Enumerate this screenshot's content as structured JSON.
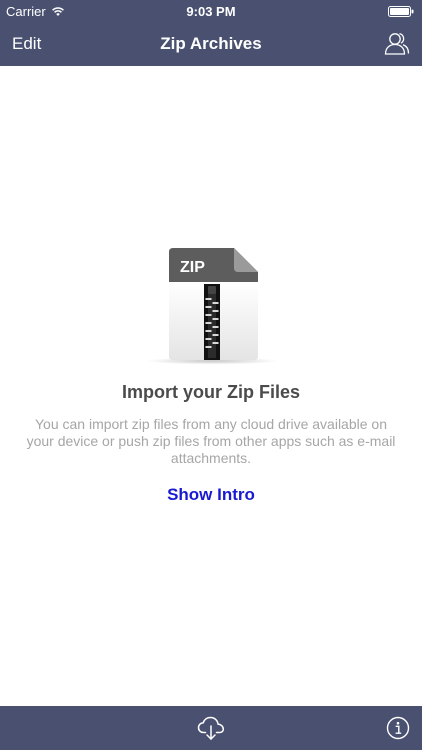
{
  "status_bar": {
    "carrier": "Carrier",
    "time": "9:03 PM"
  },
  "nav": {
    "edit_label": "Edit",
    "title": "Zip Archives",
    "profile_icon": "person-group-icon"
  },
  "empty_state": {
    "icon_label": "ZIP",
    "title": "Import your Zip Files",
    "description": "You can import zip files from any cloud drive available on your device or push zip files from other apps such as e-mail attachments.",
    "show_intro_label": "Show Intro"
  },
  "toolbar": {
    "cloud_icon": "cloud-download-icon",
    "info_icon": "info-icon"
  },
  "colors": {
    "bar": "#4a5170",
    "link": "#1a1ad3",
    "title_text": "#4b4b4b",
    "desc_text": "#a6a6a6"
  }
}
